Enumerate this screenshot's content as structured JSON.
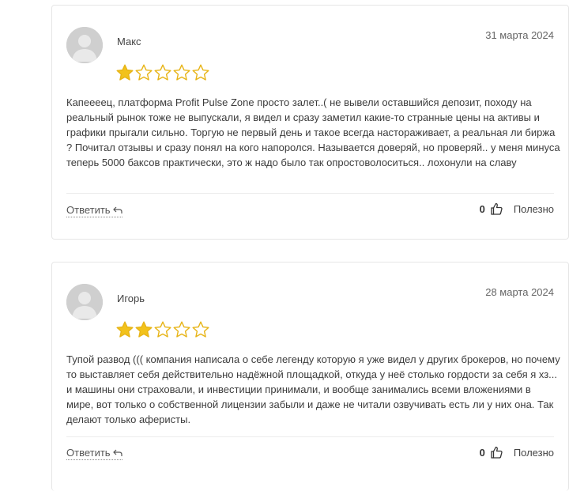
{
  "reviews": [
    {
      "author": "Макс",
      "date": "31 марта 2024",
      "rating": 1,
      "max_rating": 5,
      "text": "Капеееец, платформа Profit Pulse Zone просто залет..( не вывели оставшийся депозит, походу на реальный рынок тоже не выпускали, я видел и сразу заметил какие-то странные цены на активы и графики прыгали сильно. Торгую не первый день и такое всегда настораживает, а реальная ли биржа ? Почитал отзывы и сразу понял на кого напоролся. Называется доверяй, но проверяй.. у меня минуса теперь 5000 баксов практически, это ж надо было так опростоволоситься.. лохонули на славу",
      "reply_label": "Ответить",
      "helpful_count": "0",
      "helpful_label": "Полезно"
    },
    {
      "author": "Игорь",
      "date": "28 марта 2024",
      "rating": 2,
      "max_rating": 5,
      "text": "Тупой развод ((( компания написала о себе легенду которую я уже видел у других брокеров, но почему то выставляет себя действительно надёжной площадкой, откуда у неё столько гордости за себя я хз... и машины они страховали, и инвестиции принимали, и вообще занимались всеми вложениями в мире, вот только о собственной лицензии забыли и даже не читали озвучивать есть ли у них она. Так делают только аферисты.",
      "reply_label": "Ответить",
      "helpful_count": "0",
      "helpful_label": "Полезно"
    }
  ],
  "colors": {
    "star_fill": "#f2c21b",
    "star_outline": "#e7b416",
    "avatar_bg": "#cfcfcf"
  },
  "icons": {
    "avatar": "user-silhouette-icon",
    "star": "star-icon",
    "reply": "reply-arrow-icon",
    "like": "thumbs-up-icon"
  }
}
